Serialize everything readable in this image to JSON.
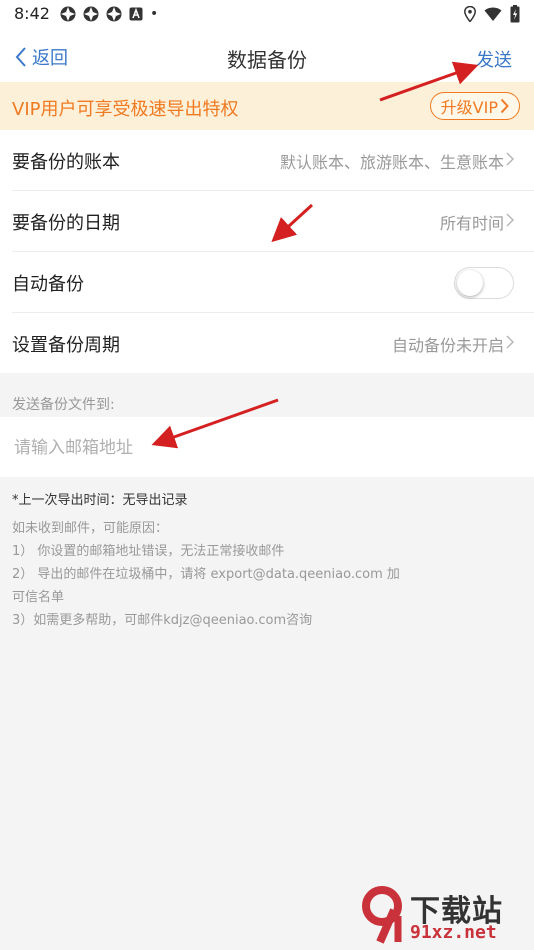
{
  "status_bar": {
    "time": "8:42",
    "left_icons": [
      "app-notification-icon",
      "app-notification-icon",
      "app-notification-icon",
      "a-notification-icon",
      "dot-icon"
    ],
    "dot": "•"
  },
  "nav": {
    "back_label": "返回",
    "title": "数据备份",
    "send_label": "发送"
  },
  "vip_banner": {
    "text": "VIP用户可享受极速导出特权",
    "button_label": "升级VIP"
  },
  "settings": {
    "rows": [
      {
        "label": "要备份的账本",
        "value": "默认账本、旅游账本、生意账本"
      },
      {
        "label": "要备份的日期",
        "value": "所有时间"
      },
      {
        "label": "自动备份",
        "toggle_on": false
      },
      {
        "label": "设置备份周期",
        "value": "自动备份未开启"
      }
    ]
  },
  "email": {
    "section_label": "发送备份文件到:",
    "placeholder": "请输入邮箱地址",
    "value": ""
  },
  "info": {
    "last_export": "*上一次导出时间：无导出记录",
    "notes": [
      "如未收到邮件，可能原因：",
      "1） 你设置的邮箱地址错误，无法正常接收邮件",
      "2） 导出的邮件在垃圾桶中，请将 export@data.qeeniao.com 加",
      "可信名单",
      "3）如需更多帮助，可邮件kdjz@qeeniao.com咨询"
    ]
  },
  "watermark": {
    "title": "下载站",
    "url": "91xz.net"
  },
  "colors": {
    "accent": "#3a78c9",
    "vip_orange": "#f07a22",
    "vip_bg": "#fcf0d8",
    "annotation_red": "#d42020"
  }
}
